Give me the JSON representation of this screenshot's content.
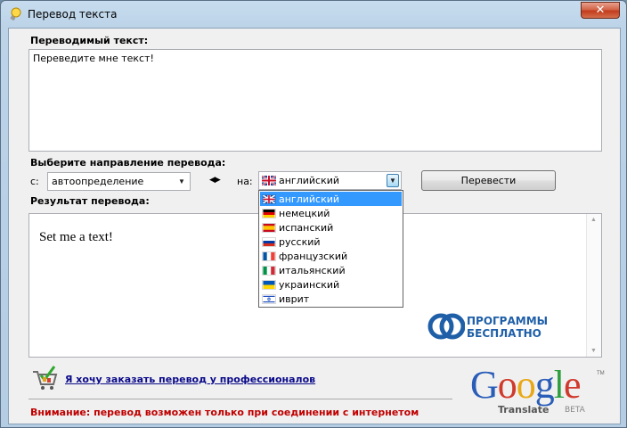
{
  "window": {
    "title": "Перевод текста",
    "close_glyph": "✕"
  },
  "source": {
    "label": "Переводимый текст:",
    "text": "Переведите мне текст!"
  },
  "direction": {
    "label": "Выберите направление перевода:",
    "from_label": "с:",
    "from_value": "автоопределение",
    "swap_glyph": "◀▶",
    "to_label": "на:",
    "to_value": "английский"
  },
  "translate_button": "Перевести",
  "result": {
    "label": "Результат перевода:",
    "text": "Set me a text!"
  },
  "language_options": [
    {
      "label": "английский",
      "flag": "gb",
      "selected": true
    },
    {
      "label": "немецкий",
      "flag": "de"
    },
    {
      "label": "испанский",
      "flag": "es"
    },
    {
      "label": "русский",
      "flag": "ru"
    },
    {
      "label": "французский",
      "flag": "fr"
    },
    {
      "label": "итальянский",
      "flag": "it"
    },
    {
      "label": "украинский",
      "flag": "ua"
    },
    {
      "label": "иврит",
      "flag": "il"
    }
  ],
  "promo": {
    "line1": "ПРОГРАММЫ",
    "line2": "БЕСПЛАТНО"
  },
  "order_link": "Я хочу заказать перевод у профессионалов",
  "warning": "Внимание: перевод возможен только при соединении с интернетом",
  "google": {
    "word": "Google",
    "translate": "Translate",
    "beta": "BETA",
    "tm": "TM"
  },
  "colors": {
    "warning": "#c00000",
    "link": "#0a0a8a",
    "selection": "#3399ff",
    "promo": "#1f5fa8"
  }
}
